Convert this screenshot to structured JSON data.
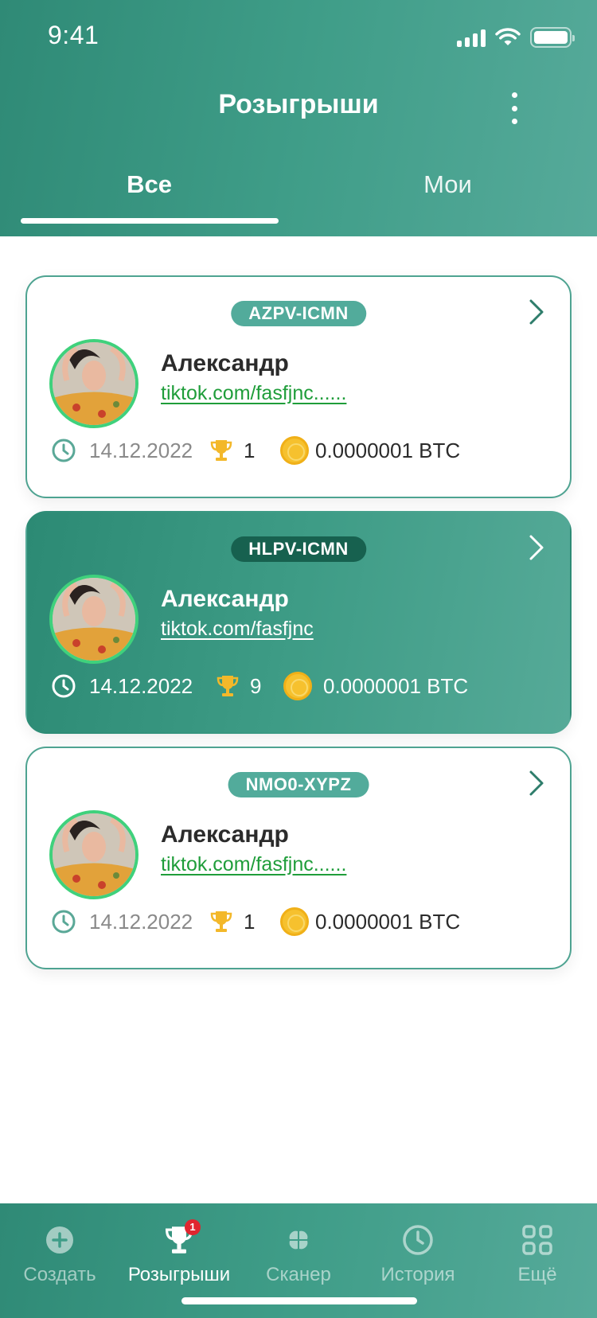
{
  "status_bar": {
    "time": "9:41"
  },
  "header": {
    "title": "Розыгрыши"
  },
  "tabs": [
    {
      "label": "Все",
      "active": true
    },
    {
      "label": "Мои",
      "active": false
    }
  ],
  "giveaways": [
    {
      "code": "AZPV-ICMN",
      "name": "Александр",
      "link": "tiktok.com/fasfjnc......",
      "date": "14.12.2022",
      "winners": "1",
      "prize": "0.0000001 BTC",
      "highlighted": false
    },
    {
      "code": "HLPV-ICMN",
      "name": "Александр",
      "link": "tiktok.com/fasfjnc",
      "date": "14.12.2022",
      "winners": "9",
      "prize": "0.0000001 BTC",
      "highlighted": true
    },
    {
      "code": "NMO0-XYPZ",
      "name": "Александр",
      "link": "tiktok.com/fasfjnc......",
      "date": "14.12.2022",
      "winners": "1",
      "prize": "0.0000001 BTC",
      "highlighted": false
    }
  ],
  "bottom_nav": [
    {
      "label": "Создать",
      "icon": "plus-circle-icon",
      "active": false
    },
    {
      "label": "Розыгрыши",
      "icon": "trophy-icon",
      "active": true,
      "badge": "1"
    },
    {
      "label": "Сканер",
      "icon": "clover-icon",
      "active": false
    },
    {
      "label": "История",
      "icon": "clock-icon",
      "active": false
    },
    {
      "label": "Ещё",
      "icon": "grid-icon",
      "active": false
    }
  ],
  "colors": {
    "primary": "#3f9d88",
    "badge_dark": "#17614f",
    "badge_light": "#52ab9b",
    "link": "#1f9d3a",
    "coin": "#f6c12e",
    "notification": "#e0262f"
  }
}
